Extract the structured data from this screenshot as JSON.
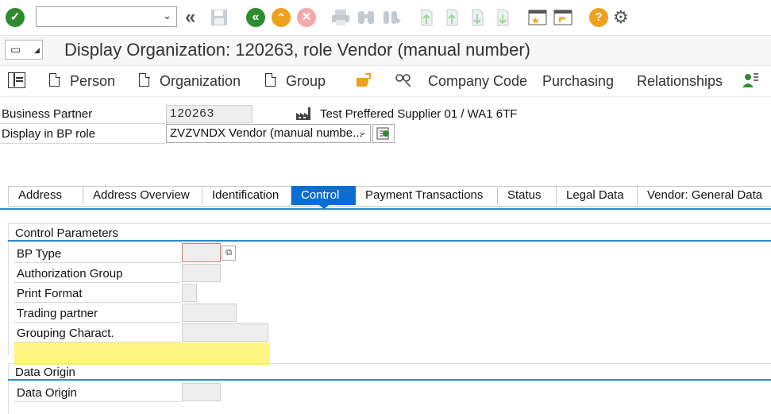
{
  "toolbar": {
    "command_field_value": "",
    "icons": [
      "enter-icon",
      "command-dropdown-icon",
      "double-left-icon",
      "save-icon",
      "back-icon",
      "exit-icon",
      "cancel-icon",
      "print-icon",
      "find-icon",
      "find-next-icon",
      "first-page-icon",
      "previous-page-icon",
      "next-page-icon",
      "last-page-icon",
      "create-session-icon",
      "shortcut-icon",
      "help-icon",
      "settings-icon"
    ]
  },
  "title": "Display Organization: 120263, role Vendor (manual number)",
  "app_toolbar": {
    "person": "Person",
    "organization": "Organization",
    "group": "Group",
    "company_code": "Company Code",
    "purchasing": "Purchasing",
    "relationships": "Relationships"
  },
  "header": {
    "bp_label": "Business Partner",
    "bp_value": "120263",
    "bp_description": "Test Preffered Supplier 01 / WA1 6TF",
    "role_label": "Display in BP role",
    "role_value": "ZVZVNDX Vendor (manual numbe..."
  },
  "tabs": [
    {
      "label": "Address"
    },
    {
      "label": "Address Overview"
    },
    {
      "label": "Identification"
    },
    {
      "label": "Control"
    },
    {
      "label": "Payment Transactions"
    },
    {
      "label": "Status"
    },
    {
      "label": "Legal Data"
    },
    {
      "label": "Vendor: General Data"
    }
  ],
  "control_parameters": {
    "title": "Control Parameters",
    "fields": [
      {
        "label": "BP Type",
        "value": ""
      },
      {
        "label": "Authorization Group",
        "value": ""
      },
      {
        "label": "Print Format",
        "value": ""
      },
      {
        "label": "Trading partner",
        "value": ""
      },
      {
        "label": "Grouping Charact.",
        "value": ""
      }
    ]
  },
  "data_origin": {
    "title": "Data Origin",
    "fields": [
      {
        "label": "Data Origin",
        "value": ""
      }
    ]
  },
  "colors": {
    "accent": "#0a6ed1",
    "tab_line": "#2a8ac9",
    "highlight": "#fff36b",
    "enter_green": "#2e8b2e",
    "back_green": "#2e8b2e",
    "exit_orange": "#f0a11c",
    "help_orange": "#f0a11c",
    "field_bg": "#eeeeee"
  }
}
